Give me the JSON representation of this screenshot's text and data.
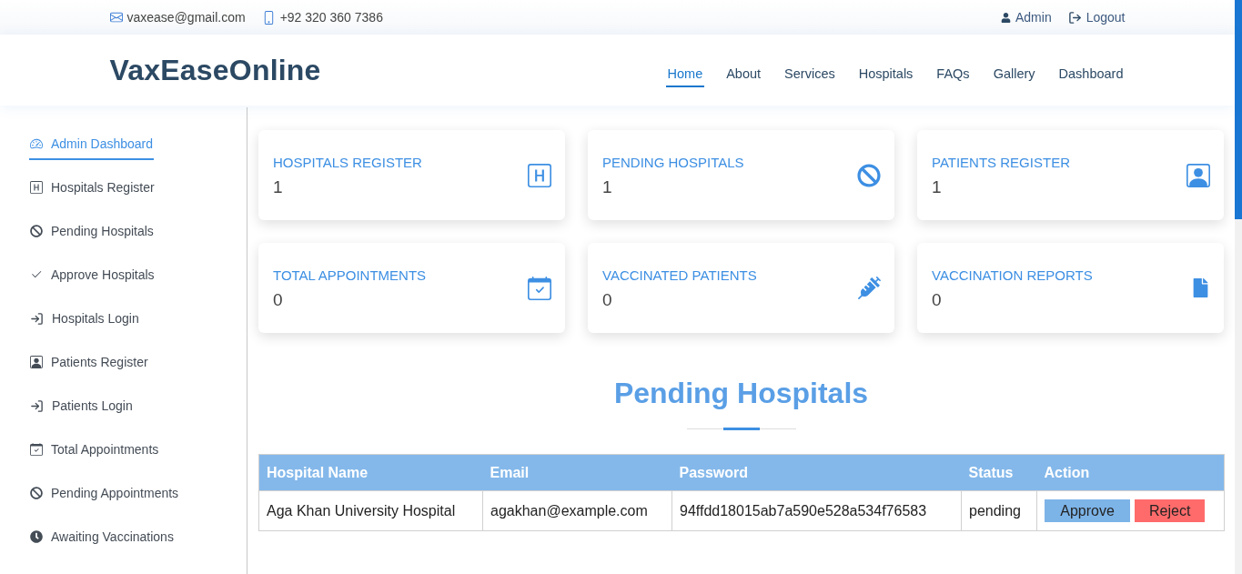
{
  "top_bar": {
    "email": "vaxease@gmail.com",
    "phone": "+92 320 360 7386",
    "user": "Admin",
    "logout": "Logout"
  },
  "header": {
    "logo": "VaxEaseOnline",
    "nav": [
      {
        "label": "Home",
        "selected": true
      },
      {
        "label": "About",
        "selected": false
      },
      {
        "label": "Services",
        "selected": false
      },
      {
        "label": "Hospitals",
        "selected": false
      },
      {
        "label": "FAQs",
        "selected": false
      },
      {
        "label": "Gallery",
        "selected": false
      },
      {
        "label": "Dashboard",
        "selected": false
      }
    ]
  },
  "sidebar": {
    "items": [
      {
        "label": "Admin Dashboard",
        "selected": true
      },
      {
        "label": "Hospitals Register",
        "selected": false
      },
      {
        "label": "Pending Hospitals",
        "selected": false
      },
      {
        "label": "Approve Hospitals",
        "selected": false
      },
      {
        "label": "Hospitals Login",
        "selected": false
      },
      {
        "label": "Patients Register",
        "selected": false
      },
      {
        "label": "Patients Login",
        "selected": false
      },
      {
        "label": "Total Appointments",
        "selected": false
      },
      {
        "label": "Pending Appointments",
        "selected": false
      },
      {
        "label": "Awaiting Vaccinations",
        "selected": false
      }
    ]
  },
  "stats": [
    {
      "title": "HOSPITALS REGISTER",
      "value": "1"
    },
    {
      "title": "PENDING HOSPITALS",
      "value": "1"
    },
    {
      "title": "PATIENTS REGISTER",
      "value": "1"
    },
    {
      "title": "TOTAL APPOINTMENTS",
      "value": "0"
    },
    {
      "title": "VACCINATED PATIENTS",
      "value": "0"
    },
    {
      "title": "VACCINATION REPORTS",
      "value": "0"
    }
  ],
  "section": {
    "title": "Pending Hospitals"
  },
  "table": {
    "columns": [
      "Hospital Name",
      "Email",
      "Password",
      "Status",
      "Action"
    ],
    "rows": [
      {
        "cells": [
          "Aga Khan University Hospital",
          "agakhan@example.com",
          "94ffdd18015ab7a590e528a534f76583",
          "pending"
        ],
        "actions": [
          {
            "label": "Approve",
            "kind": "approve"
          },
          {
            "label": "Reject",
            "kind": "reject"
          }
        ]
      }
    ]
  }
}
